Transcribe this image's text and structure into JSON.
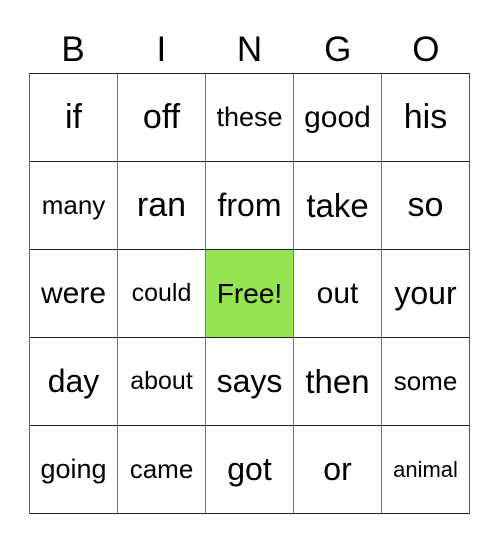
{
  "header": [
    "B",
    "I",
    "N",
    "G",
    "O"
  ],
  "colors": {
    "free_cell": "#95E552",
    "cell_bg": "#FFFFFF"
  },
  "cells": [
    [
      {
        "text": "if",
        "size": 34
      },
      {
        "text": "off",
        "size": 34
      },
      {
        "text": "these",
        "size": 27
      },
      {
        "text": "good",
        "size": 30
      },
      {
        "text": "his",
        "size": 34
      }
    ],
    [
      {
        "text": "many",
        "size": 26
      },
      {
        "text": "ran",
        "size": 34
      },
      {
        "text": "from",
        "size": 32
      },
      {
        "text": "take",
        "size": 33
      },
      {
        "text": "so",
        "size": 34
      }
    ],
    [
      {
        "text": "were",
        "size": 30
      },
      {
        "text": "could",
        "size": 25
      },
      {
        "text": "Free!",
        "size": 28,
        "free": true
      },
      {
        "text": "out",
        "size": 30
      },
      {
        "text": "your",
        "size": 32
      }
    ],
    [
      {
        "text": "day",
        "size": 32
      },
      {
        "text": "about",
        "size": 25
      },
      {
        "text": "says",
        "size": 32
      },
      {
        "text": "then",
        "size": 33
      },
      {
        "text": "some",
        "size": 26
      }
    ],
    [
      {
        "text": "going",
        "size": 27
      },
      {
        "text": "came",
        "size": 26
      },
      {
        "text": "got",
        "size": 32
      },
      {
        "text": "or",
        "size": 32
      },
      {
        "text": "animal",
        "size": 22
      }
    ]
  ]
}
